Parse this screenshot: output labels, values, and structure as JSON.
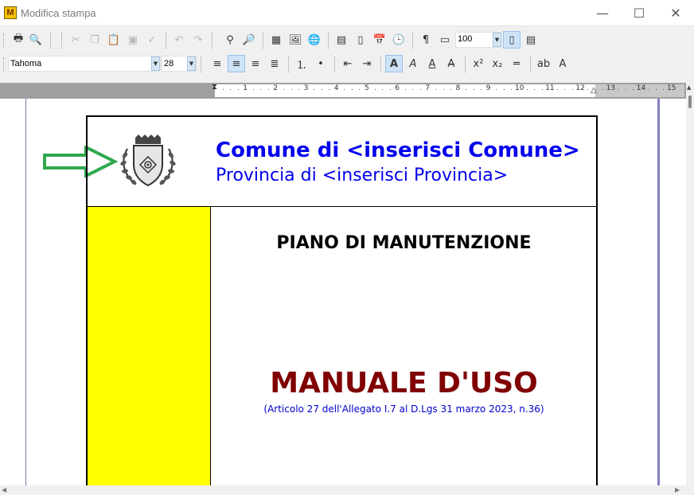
{
  "window": {
    "title": "Modifica stampa",
    "app_icon_letter": "M",
    "minimize_glyph": "—",
    "maximize_glyph": "☐",
    "close_glyph": "✕"
  },
  "toolbar1": {
    "zoom_value": "100"
  },
  "toolbar2": {
    "font_name": "Tahoma",
    "font_size": "28"
  },
  "ruler": {
    "numbers": [
      "1",
      "2",
      "3",
      "4",
      "5",
      "6",
      "7",
      "8",
      "9",
      "10",
      "11",
      "12",
      "13",
      "14",
      "15"
    ]
  },
  "document": {
    "comune": "Comune di <inserisci Comune>",
    "provincia": "Provincia di <inserisci Provincia>",
    "piano": "PIANO DI MANUTENZIONE",
    "manuale": "MANUALE D'USO",
    "articolo": "(Articolo 27 dell'Allegato I.7 al D.Lgs 31 marzo 2023, n.36)"
  },
  "colors": {
    "comune_text": "#0000ee",
    "manuale_text": "#800000",
    "yellow_column": "#ffff00",
    "arrow": "#2fa84f"
  }
}
